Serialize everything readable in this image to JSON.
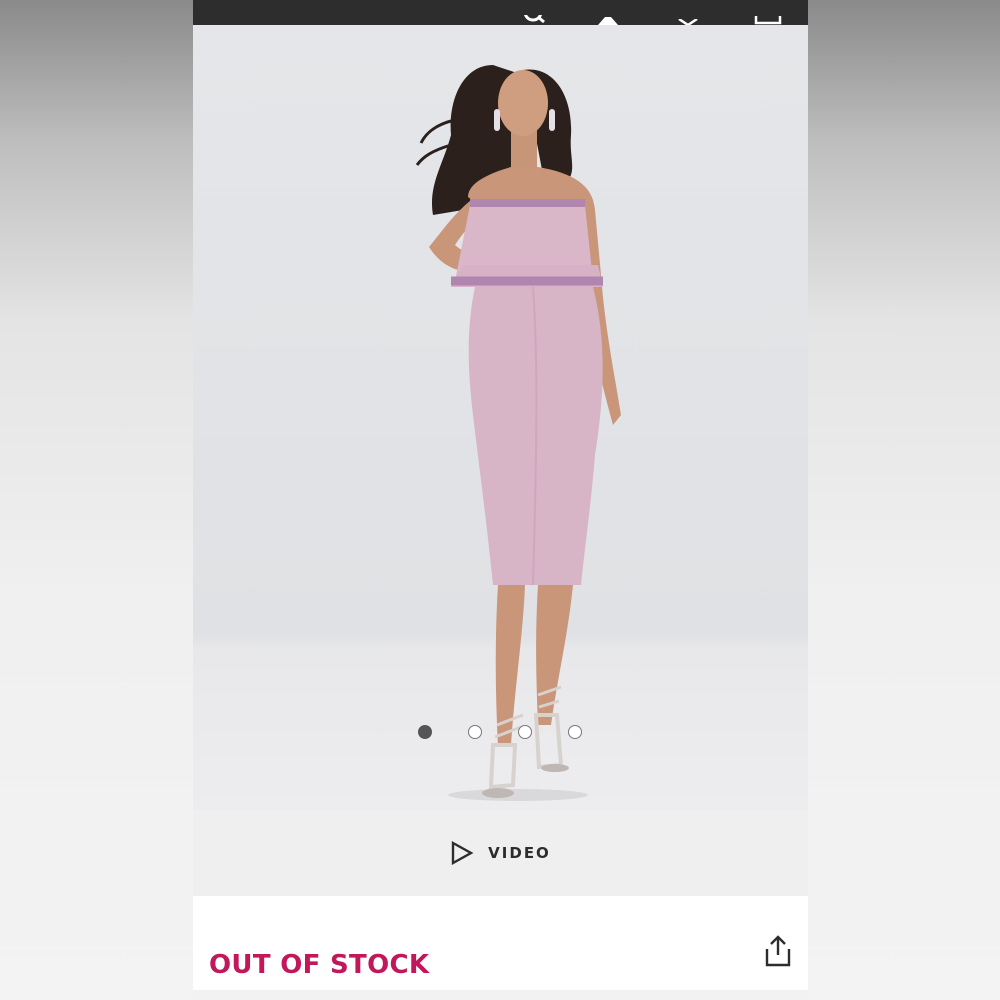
{
  "header": {
    "icons": [
      "search-icon",
      "account-icon",
      "heart-icon",
      "bag-icon"
    ]
  },
  "gallery": {
    "image": "model-in-pink-strapless-midi-dress",
    "dot_count": 4,
    "active_index": 0
  },
  "video": {
    "label": "VIDEO",
    "icon": "play-icon"
  },
  "product": {
    "status": "OUT OF STOCK",
    "share_icon": "share-icon"
  },
  "colors": {
    "status": "#c2185b",
    "topbar": "#2d2d2d",
    "dress": "#d7b3c6"
  }
}
